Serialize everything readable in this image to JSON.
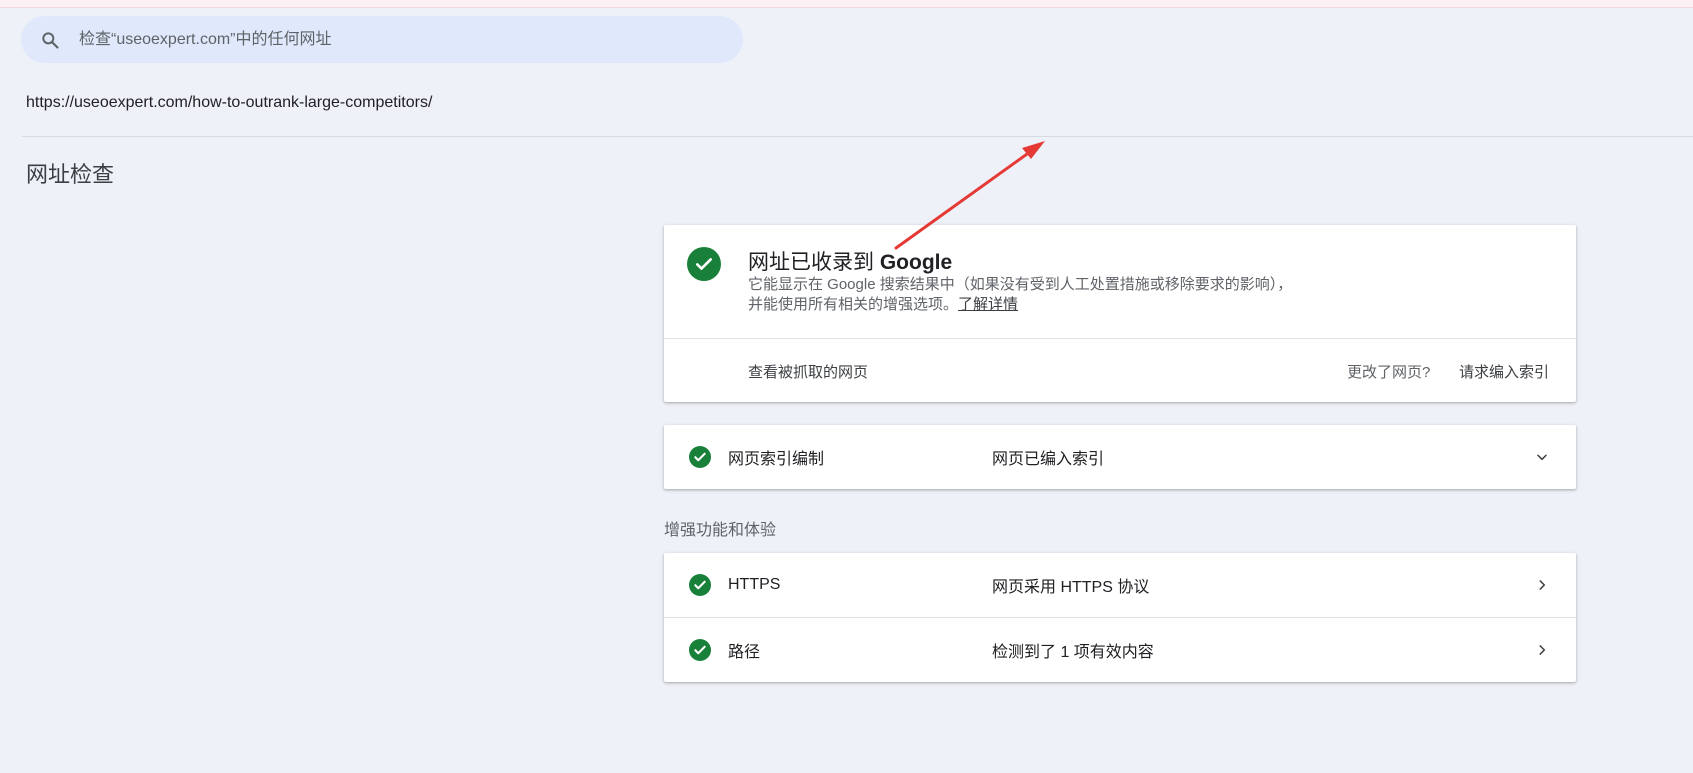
{
  "search": {
    "placeholder": "检查“useoexpert.com”中的任何网址"
  },
  "inspected_url": "https://useoexpert.com/how-to-outrank-large-competitors/",
  "page_title": "网址检查",
  "status_card": {
    "title_prefix": "网址已收录到 ",
    "title_brand": "Google",
    "description": "它能显示在 Google 搜索结果中（如果没有受到人工处置措施或移除要求的影响），并能使用所有相关的增强选项。",
    "learn_more": "了解详情",
    "view_crawled": "查看被抓取的网页",
    "page_changed": "更改了网页?",
    "request_indexing": "请求编入索引"
  },
  "indexing": {
    "label": "网页索引编制",
    "value": "网页已编入索引"
  },
  "enhancements": {
    "heading": "增强功能和体验",
    "items": [
      {
        "label": "HTTPS",
        "value": "网页采用 HTTPS 协议"
      },
      {
        "label": "路径",
        "value": "检测到了 1 项有效内容"
      }
    ]
  },
  "colors": {
    "success": "#188038",
    "annotation_arrow": "#e53935",
    "background": "#eef2f8"
  },
  "icons": {
    "search": "search-icon",
    "status": "check-circle-icon",
    "expand": "chevron-down-icon",
    "open": "chevron-right-icon"
  }
}
